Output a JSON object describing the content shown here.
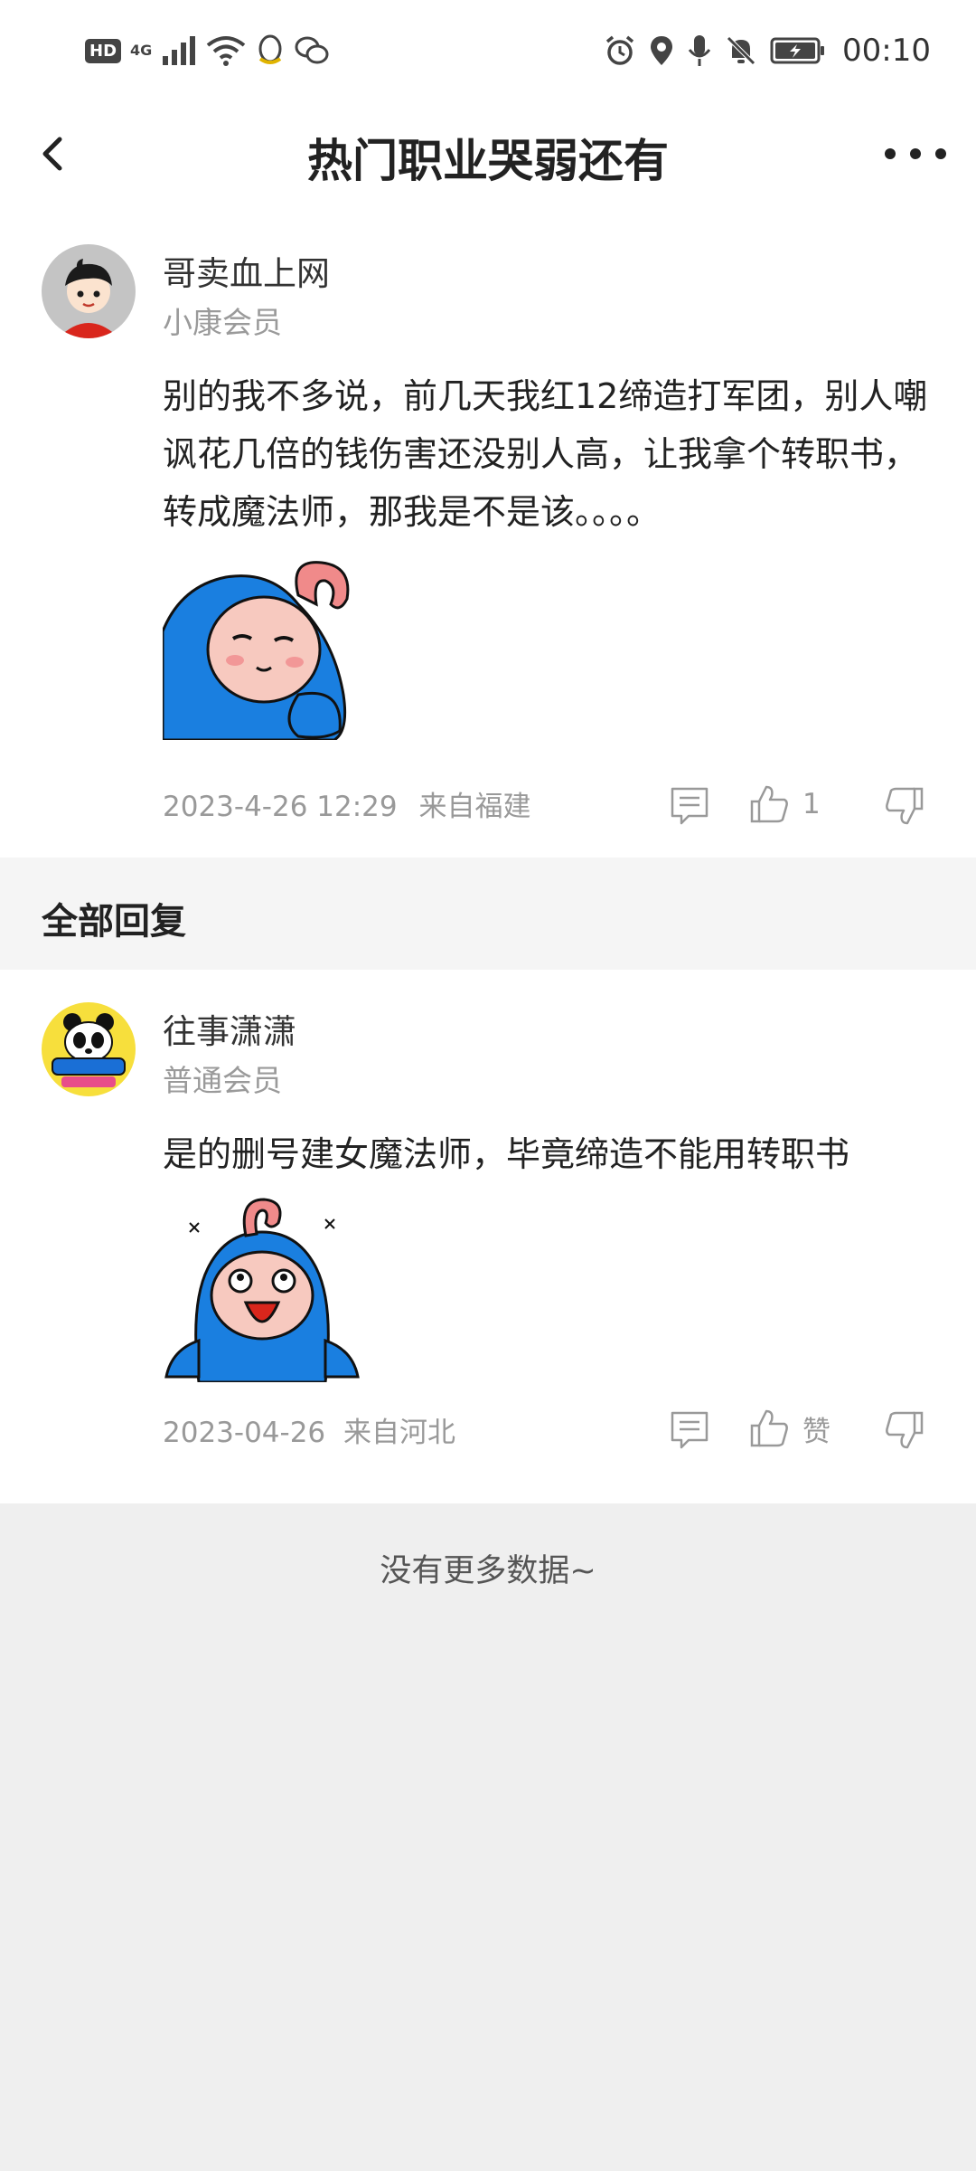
{
  "status_bar": {
    "hd": "HD",
    "network": "4G",
    "time": "00:10"
  },
  "nav": {
    "title": "热门职业哭弱还有"
  },
  "post": {
    "author": "哥卖血上网",
    "level": "小康会员",
    "content": "别的我不多说，前几天我红12缔造打军团，别人嘲讽花几倍的钱伤害还没别人高，让我拿个转职书，转成魔法师，那我是不是该。。。。",
    "time": "2023-4-26 12:29",
    "location": "来自福建",
    "like_count": "1"
  },
  "section": {
    "title": "全部回复"
  },
  "reply": {
    "author": "往事潇潇",
    "level": "普通会员",
    "content": "是的删号建女魔法师，毕竟缔造不能用转职书",
    "time": "2023-04-26",
    "location": "来自河北",
    "like_label": "赞"
  },
  "footer": {
    "no_more": "没有更多数据~"
  },
  "colors": {
    "mascot_blue": "#1a7fe0",
    "mascot_skin": "#f7c9bf",
    "page_bg": "#efefef"
  }
}
